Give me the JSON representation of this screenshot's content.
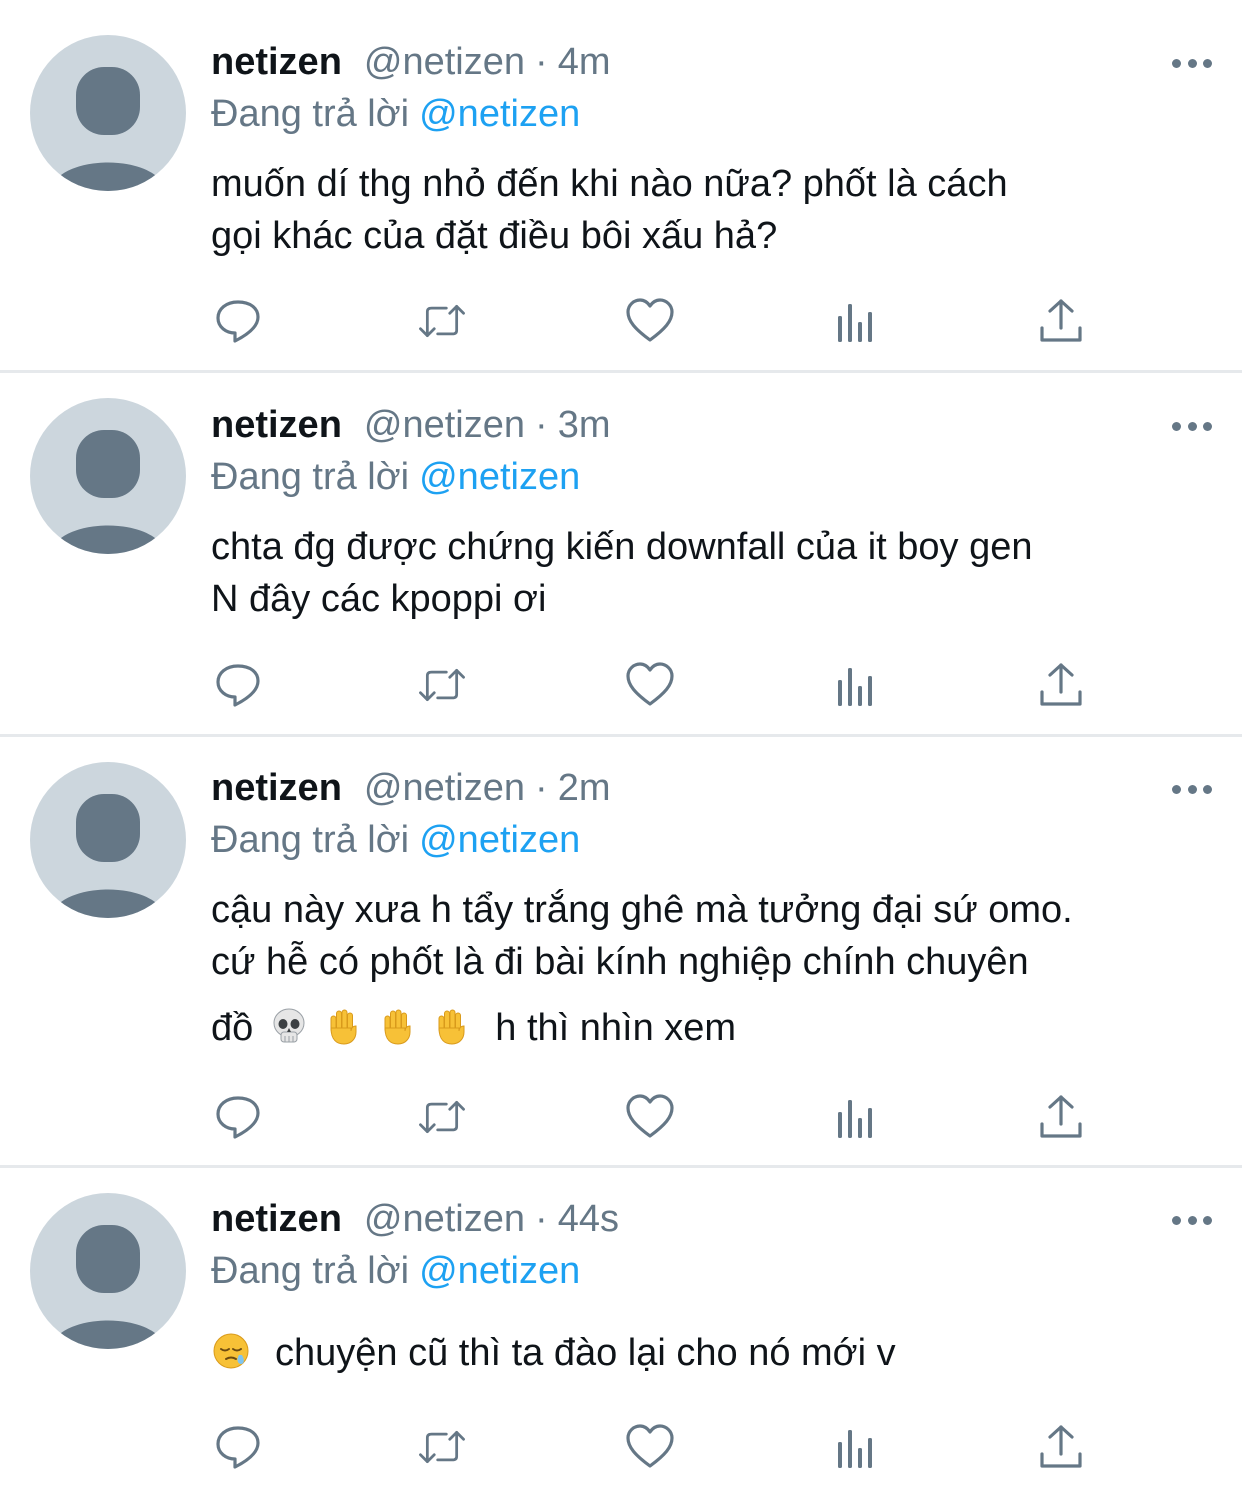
{
  "colors": {
    "name": "#0f1419",
    "muted": "#657786",
    "link": "#1da1f2",
    "divider": "#e6e9ec",
    "avatar_bg": "#ccd6dd",
    "avatar_fg": "#657786"
  },
  "reply_prefix": "Đang trả lời",
  "tweets": [
    {
      "name": "netizen",
      "handle": "@netizen",
      "separator": "·",
      "time": "4m",
      "reply_to": "@netizen",
      "text_lines": [
        "muốn dí thg nhỏ đến khi nào nữa? phốt là cách",
        "gọi khác của đặt điều bôi xấu hả?"
      ],
      "icons": [
        "reply-icon",
        "retweet-icon",
        "like-icon",
        "analytics-icon",
        "share-icon"
      ]
    },
    {
      "name": "netizen",
      "handle": "@netizen",
      "separator": "·",
      "time": "3m",
      "reply_to": "@netizen",
      "text_lines": [
        "chta đg được chứng kiến downfall của it boy gen",
        "N đây các kpoppi ơi"
      ],
      "icons": [
        "reply-icon",
        "retweet-icon",
        "like-icon",
        "analytics-icon",
        "share-icon"
      ]
    },
    {
      "name": "netizen",
      "handle": "@netizen",
      "separator": "·",
      "time": "2m",
      "reply_to": "@netizen",
      "text_lines": [
        "cậu này xưa h tẩy trắng ghê mà tưởng đại sứ omo.",
        "cứ hễ có phốt là đi bài kính nghiệp chính chuyên"
      ],
      "text_line3_prefix": "đồ",
      "emojis": [
        "skull-emoji",
        "raised-hand-emoji",
        "raised-hand-emoji",
        "raised-hand-emoji"
      ],
      "text_line3_suffix": "h thì nhìn xem",
      "icons": [
        "reply-icon",
        "retweet-icon",
        "like-icon",
        "analytics-icon",
        "share-icon"
      ]
    },
    {
      "name": "netizen",
      "handle": "@netizen",
      "separator": "·",
      "time": "44s",
      "reply_to": "@netizen",
      "lead_emoji": "sleepy-face-emoji",
      "text_line": "chuyện cũ thì ta đào lại cho nó mới v",
      "icons": [
        "reply-icon",
        "retweet-icon",
        "like-icon",
        "analytics-icon",
        "share-icon"
      ]
    }
  ]
}
